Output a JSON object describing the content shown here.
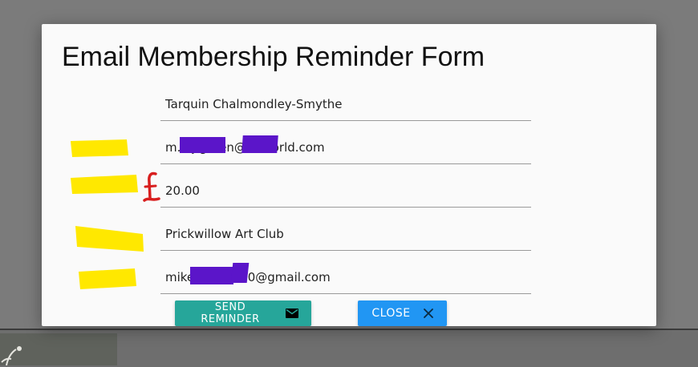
{
  "dialog": {
    "title": "Email Membership Reminder Form"
  },
  "form": {
    "name": "Tarquin Chalmondley-Smythe",
    "email": "m.d.j.green@ntlworld.com",
    "amount": "20.00",
    "currency_symbol": "£",
    "club": "Prickwillow Art Club",
    "club_email": "mikedjgreen60@gmail.com"
  },
  "buttons": {
    "send_label": "SEND REMINDER",
    "send_icon": "email-icon",
    "close_label": "CLOSE",
    "close_icon": "close-icon"
  },
  "colors": {
    "overlay": "#7b7b7b",
    "send_button": "#26a69a",
    "close_button": "#2196f3",
    "redaction": "#5b15c9",
    "highlight": "#ffe800",
    "currency_mark": "#d81e1e"
  }
}
